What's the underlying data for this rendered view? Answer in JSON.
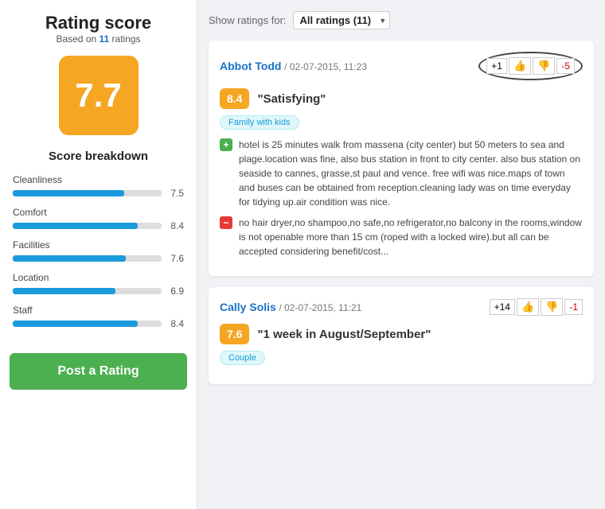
{
  "left": {
    "title": "Rating score",
    "subtitle_pre": "Based on ",
    "subtitle_count": "11",
    "subtitle_post": " ratings",
    "score": "7.7",
    "breakdown_title": "Score breakdown",
    "breakdown": [
      {
        "label": "Cleanliness",
        "score": "7.5",
        "pct": 75
      },
      {
        "label": "Comfort",
        "score": "8.4",
        "pct": 84
      },
      {
        "label": "Facilities",
        "score": "7.6",
        "pct": 76
      },
      {
        "label": "Location",
        "score": "6.9",
        "pct": 69
      },
      {
        "label": "Staff",
        "score": "8.4",
        "pct": 84
      }
    ],
    "post_rating_btn": "Post a Rating"
  },
  "right": {
    "filter_label": "Show ratings for:",
    "filter_value": "All ratings (11)",
    "reviews": [
      {
        "reviewer": "Abbot Todd",
        "date": "02-07-2015, 11:23",
        "vote_plus": "+1",
        "vote_minus": "-5",
        "score": "8.4",
        "title": "\"Satisfying\"",
        "tag": "Family with kids",
        "pos_text": "hotel is 25 minutes walk from massena (city center) but 50 meters to sea and plage.location was fine, also bus station in front to city center. also bus station on seaside to cannes, grasse,st paul and vence. free wifi was nice.maps of town and buses can be obtained from reception.cleaning lady was on time everyday for tidying up.air condition was nice.",
        "neg_text": "no hair dryer,no shampoo,no safe,no refrigerator,no balcony in the rooms,window is not openable more than 15 cm (roped with a locked wire).but all can be accepted considering benefit/cost..."
      },
      {
        "reviewer": "Cally Solis",
        "date": "02-07-2015, 11:21",
        "vote_plus": "+14",
        "vote_minus": "-1",
        "score": "7.6",
        "title": "\"1 week in August/September\"",
        "tag": "Couple",
        "pos_text": "",
        "neg_text": ""
      }
    ]
  }
}
